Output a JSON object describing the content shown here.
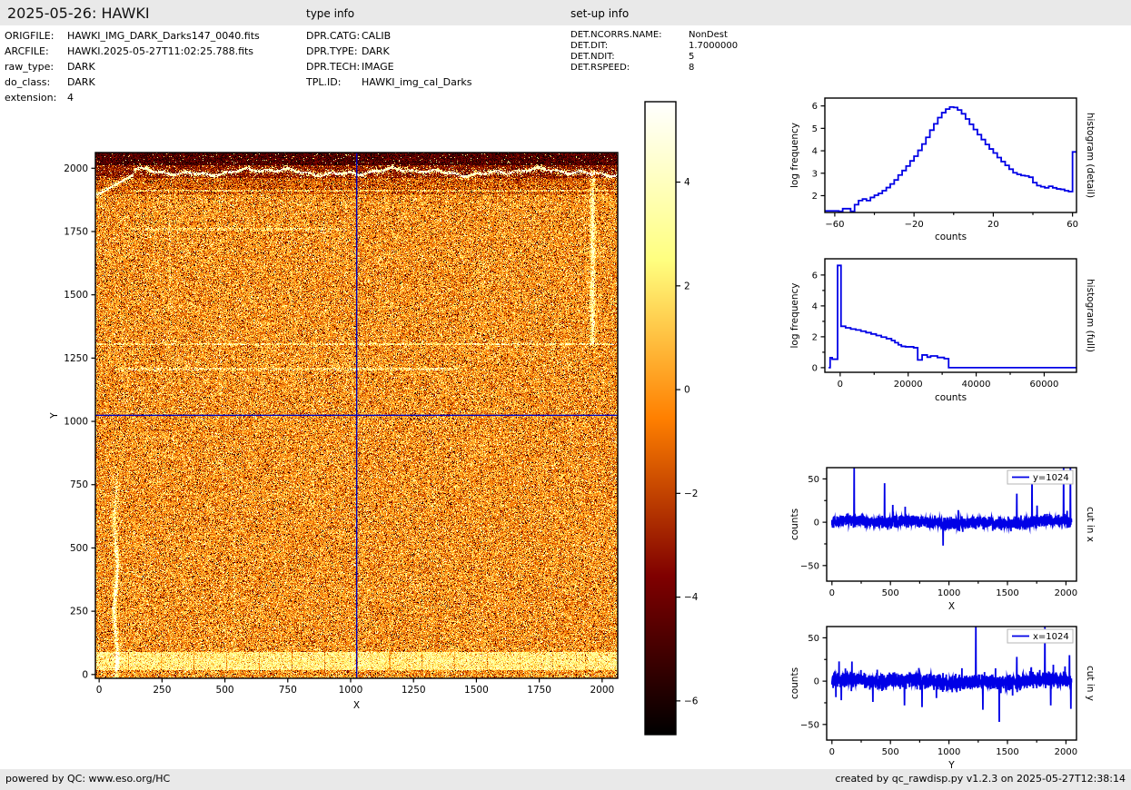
{
  "header": {
    "title": "2025-05-26: HAWKI",
    "type_info_label": "type info",
    "setup_info_label": "set-up info",
    "file_meta": [
      {
        "label": "ORIGFILE:",
        "value": "HAWKI_IMG_DARK_Darks147_0040.fits"
      },
      {
        "label": "ARCFILE:",
        "value": "HAWKI.2025-05-27T11:02:25.788.fits"
      },
      {
        "label": "raw_type:",
        "value": "DARK"
      },
      {
        "label": "do_class:",
        "value": "DARK"
      },
      {
        "label": "extension:",
        "value": "4"
      }
    ],
    "type_meta": [
      {
        "label": "DPR.CATG:",
        "value": "CALIB"
      },
      {
        "label": "DPR.TYPE:",
        "value": "DARK"
      },
      {
        "label": "DPR.TECH:",
        "value": "IMAGE"
      },
      {
        "label": "TPL.ID:",
        "value": "HAWKI_img_cal_Darks"
      }
    ],
    "setup_meta": [
      {
        "label": "DET.NCORRS.NAME:",
        "value": "NonDest"
      },
      {
        "label": "DET.DIT:",
        "value": "1.7000000"
      },
      {
        "label": "DET.NDIT:",
        "value": "5"
      },
      {
        "label": "DET.RSPEED:",
        "value": "8"
      }
    ]
  },
  "footer": {
    "left": "powered by QC: www.eso.org/HC",
    "right": "created by qc_rawdisp.py v1.2.3 on 2025-05-27T12:38:14"
  },
  "chart_data": [
    {
      "id": "main-image",
      "type": "heatmap",
      "xlabel": "X",
      "ylabel": "Y",
      "xlim": [
        -15,
        2062
      ],
      "ylim": [
        -15,
        2062
      ],
      "xticks": [
        0,
        250,
        500,
        750,
        1000,
        1250,
        1500,
        1750,
        2000
      ],
      "yticks": [
        0,
        250,
        500,
        750,
        1000,
        1250,
        1500,
        1750,
        2000
      ],
      "colormap": "afmhot",
      "vmin": -6.65,
      "vmax": 5.55,
      "colorbar_tick_values": [
        4,
        2,
        0,
        -2,
        -4,
        -6
      ],
      "crosshair": {
        "x": 1024,
        "y": 1024,
        "color": "#0000c0"
      },
      "noise": {
        "seed": 987321,
        "sigma": 1.65,
        "bright_frac": 0.055,
        "dark_frac": 0.075
      },
      "features": {
        "top_black_band": {
          "y_from": 2000,
          "level": -4.8
        },
        "top_dark_band": {
          "y_from": 1950,
          "level": -3.2
        },
        "transition_band": {
          "y_from": 1885,
          "delta": -1.3
        },
        "wavy_line": {
          "y": 1972,
          "value": 4.2
        },
        "bottom_band": {
          "y_from": 32,
          "y_to": 102,
          "level": 2.7,
          "seam_period": 128
        },
        "left_streak": {
          "x": 80,
          "amp": 5.0,
          "y_center": 280,
          "y_spread": 210
        },
        "right_line": {
          "x": 1950,
          "amp": 3.8,
          "y_from": 1300,
          "y_to": 1978
        },
        "h_lines": [
          [
            1900,
            140,
            2048,
            3.0
          ],
          [
            1302,
            0,
            2048,
            3.0
          ],
          [
            1204,
            80,
            1430,
            2.6
          ],
          [
            1749,
            140,
            980,
            1.9
          ]
        ],
        "v_lines": [
          [
            290,
            1430,
            1900,
            1.8
          ],
          [
            490,
            1100,
            1900,
            1.2
          ],
          [
            545,
            100,
            560,
            1.6
          ],
          [
            770,
            1100,
            1900,
            1.1
          ]
        ]
      }
    },
    {
      "id": "hist-detail",
      "type": "line",
      "style": "step",
      "right_label": "histogram (detail)",
      "xlabel": "counts",
      "ylabel": "log frequency",
      "xlim": [
        -65,
        62
      ],
      "ylim": [
        1.25,
        6.35
      ],
      "xticks_major": [
        -60,
        -20,
        20,
        60
      ],
      "xticks_minor": [
        -40,
        0,
        40
      ],
      "yticks_major": [
        2,
        3,
        4,
        5,
        6
      ],
      "yticks_minor": [],
      "bin_start": -62,
      "bin_width": 2,
      "values": [
        1.32,
        1.32,
        1.3,
        1.42,
        1.42,
        1.3,
        1.6,
        1.78,
        1.85,
        1.78,
        1.92,
        2.02,
        2.1,
        2.22,
        2.36,
        2.52,
        2.7,
        2.92,
        3.12,
        3.32,
        3.55,
        3.76,
        4.02,
        4.3,
        4.6,
        4.92,
        5.2,
        5.48,
        5.7,
        5.86,
        5.95,
        5.93,
        5.82,
        5.65,
        5.42,
        5.18,
        4.95,
        4.72,
        4.5,
        4.28,
        4.08,
        3.9,
        3.7,
        3.52,
        3.35,
        3.18,
        3.02,
        2.95,
        2.9,
        2.88,
        2.82,
        2.58,
        2.45,
        2.4,
        2.35,
        2.42,
        2.35,
        2.3,
        2.28,
        2.22,
        2.18,
        3.95
      ],
      "color": "#0000e6"
    },
    {
      "id": "hist-full",
      "type": "line",
      "style": "poly",
      "right_label": "histogram (full)",
      "xlabel": "counts",
      "ylabel": "log frequency",
      "xlim": [
        -4500,
        69500
      ],
      "ylim": [
        -0.3,
        7.05
      ],
      "xticks_major": [
        0,
        20000,
        40000,
        60000
      ],
      "xticks_minor": [
        10000,
        30000,
        50000
      ],
      "yticks_major": [
        0,
        2,
        4,
        6
      ],
      "yticks_minor": [
        1,
        3,
        5
      ],
      "points": [
        [
          -3400,
          0
        ],
        [
          -2950,
          0
        ],
        [
          -2950,
          0.65
        ],
        [
          -2350,
          0.65
        ],
        [
          -2350,
          0.55
        ],
        [
          -750,
          0.55
        ],
        [
          -750,
          6.62
        ],
        [
          250,
          6.62
        ],
        [
          250,
          2.68
        ],
        [
          1600,
          2.68
        ],
        [
          1600,
          2.58
        ],
        [
          3100,
          2.58
        ],
        [
          3100,
          2.5
        ],
        [
          4600,
          2.5
        ],
        [
          4600,
          2.44
        ],
        [
          6100,
          2.44
        ],
        [
          6100,
          2.36
        ],
        [
          7600,
          2.36
        ],
        [
          7600,
          2.27
        ],
        [
          9100,
          2.27
        ],
        [
          9100,
          2.18
        ],
        [
          10600,
          2.18
        ],
        [
          10600,
          2.08
        ],
        [
          12100,
          2.08
        ],
        [
          12100,
          1.98
        ],
        [
          13600,
          1.98
        ],
        [
          13600,
          1.88
        ],
        [
          15100,
          1.88
        ],
        [
          15100,
          1.76
        ],
        [
          16100,
          1.76
        ],
        [
          16100,
          1.62
        ],
        [
          17100,
          1.62
        ],
        [
          17100,
          1.48
        ],
        [
          18000,
          1.48
        ],
        [
          18000,
          1.38
        ],
        [
          19200,
          1.38
        ],
        [
          19200,
          1.35
        ],
        [
          21600,
          1.35
        ],
        [
          21600,
          1.29
        ],
        [
          22800,
          1.29
        ],
        [
          22800,
          0.5
        ],
        [
          24100,
          0.5
        ],
        [
          24100,
          0.82
        ],
        [
          25600,
          0.82
        ],
        [
          25600,
          0.68
        ],
        [
          26600,
          0.68
        ],
        [
          26600,
          0.76
        ],
        [
          28600,
          0.76
        ],
        [
          28600,
          0.66
        ],
        [
          30600,
          0.66
        ],
        [
          30600,
          0.58
        ],
        [
          31900,
          0.58
        ],
        [
          31900,
          0
        ],
        [
          69500,
          0
        ]
      ],
      "color": "#0000e6"
    },
    {
      "id": "cut-x",
      "type": "line",
      "style": "noise",
      "right_label": "cut in x",
      "xlabel": "X",
      "ylabel": "counts",
      "legend": "y=1024",
      "xlim": [
        -45,
        2090
      ],
      "ylim": [
        -68,
        63
      ],
      "xticks_major": [
        0,
        500,
        1000,
        1500,
        2000
      ],
      "xticks_minor": [
        250,
        750,
        1250,
        1750
      ],
      "yticks_major": [
        -50,
        0,
        50
      ],
      "yticks_minor": [
        -25,
        25
      ],
      "noise": {
        "seed": 42,
        "sigma": 4.0,
        "n": 2048,
        "tail_frac": 0.02,
        "tail_mult": 2.2
      },
      "spikes": [
        [
          190,
          65
        ],
        [
          450,
          45
        ],
        [
          520,
          20
        ],
        [
          950,
          -27
        ],
        [
          1080,
          14
        ],
        [
          1580,
          33
        ],
        [
          1710,
          58
        ],
        [
          1980,
          65
        ],
        [
          2038,
          65
        ]
      ],
      "color": "#0000e6"
    },
    {
      "id": "cut-y",
      "type": "line",
      "style": "noise",
      "right_label": "cut in y",
      "xlabel": "Y",
      "ylabel": "counts",
      "legend": "x=1024",
      "xlim": [
        -45,
        2090
      ],
      "ylim": [
        -68,
        63
      ],
      "xticks_major": [
        0,
        500,
        1000,
        1500,
        2000
      ],
      "xticks_minor": [
        250,
        750,
        1250,
        1750
      ],
      "yticks_major": [
        -50,
        0,
        50
      ],
      "yticks_minor": [
        -25,
        25
      ],
      "noise": {
        "seed": 7,
        "sigma": 5.2,
        "n": 2048,
        "tail_frac": 0.03,
        "tail_mult": 2.0
      },
      "spikes": [
        [
          80,
          -22
        ],
        [
          350,
          -24
        ],
        [
          620,
          -28
        ],
        [
          770,
          -30
        ],
        [
          1230,
          65
        ],
        [
          1290,
          -33
        ],
        [
          1430,
          -47
        ],
        [
          1580,
          28
        ],
        [
          1820,
          65
        ],
        [
          1870,
          -28
        ],
        [
          2030,
          30
        ],
        [
          2042,
          -32
        ]
      ],
      "color": "#0000e6"
    }
  ]
}
